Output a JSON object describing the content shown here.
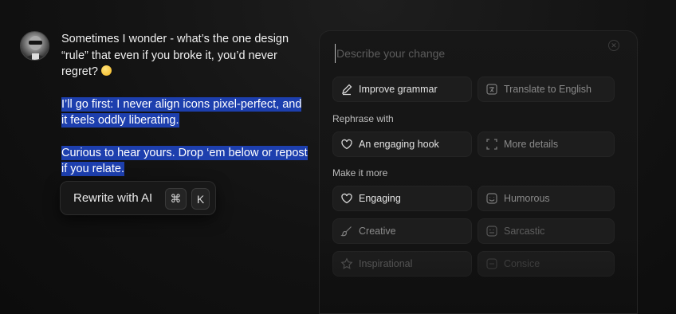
{
  "post": {
    "paragraph_1": "Sometimes I wonder - what’s the one design “rule” that even if you broke it, you’d never regret?",
    "paragraph_2": "I’ll go first: I never align icons pixel-perfect, and it feels oddly liberating.",
    "paragraph_3": "Curious to hear yours. Drop ‘em below or repost if you relate."
  },
  "rewrite_popup": {
    "label": "Rewrite with AI",
    "shortcut_key_1": "⌘",
    "shortcut_key_2": "K"
  },
  "panel": {
    "input_placeholder": "Describe your change",
    "quick_actions": [
      {
        "label": "Improve grammar",
        "icon": "pencil-icon"
      },
      {
        "label": "Translate to English",
        "icon": "translate-icon"
      }
    ],
    "rephrase_heading": "Rephrase with",
    "rephrase_options": [
      {
        "label": "An engaging hook",
        "icon": "heart-icon"
      },
      {
        "label": "More details",
        "icon": "expand-icon"
      }
    ],
    "make_more_heading": "Make it more",
    "tone_options": [
      {
        "label": "Engaging",
        "icon": "heart-icon"
      },
      {
        "label": "Humorous",
        "icon": "smile-icon"
      },
      {
        "label": "Creative",
        "icon": "brush-icon"
      },
      {
        "label": "Sarcastic",
        "icon": "wink-icon"
      },
      {
        "label": "Inspirational",
        "icon": "star-icon"
      },
      {
        "label": "Consice",
        "icon": "minus-box-icon"
      }
    ]
  }
}
